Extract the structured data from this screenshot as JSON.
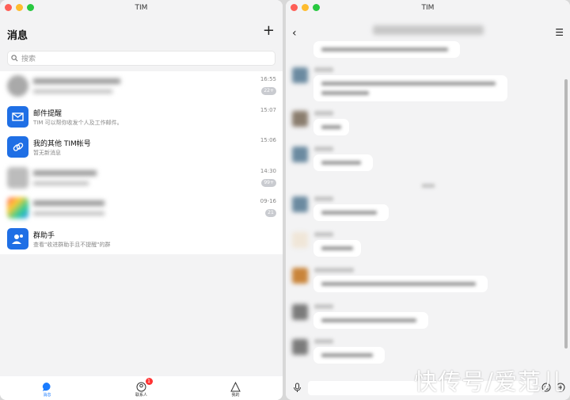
{
  "app": {
    "title": "TIM"
  },
  "left": {
    "heading": "消息",
    "plus": "+",
    "search_placeholder": "搜索",
    "rows": [
      {
        "name": "",
        "sub": "",
        "time": "16:55",
        "badge": "22+"
      },
      {
        "name": "邮件提醒",
        "sub": "TIM 可以帮你收发个人及工作邮件。",
        "time": "15:07",
        "badge": ""
      },
      {
        "name": "我的其他 TIM帐号",
        "sub": "暂无新消息",
        "time": "15:06",
        "badge": ""
      },
      {
        "name": "",
        "sub": "",
        "time": "14:30",
        "badge": "99+"
      },
      {
        "name": "",
        "sub": "",
        "time": "09-16",
        "badge": "21"
      },
      {
        "name": "群助手",
        "sub": "查看\"收进群助手且不提醒\"的群",
        "time": "",
        "badge": ""
      }
    ],
    "tabs": [
      {
        "label": "消息",
        "badge": ""
      },
      {
        "label": "联系人",
        "badge": "1"
      },
      {
        "label": "我的",
        "badge": ""
      }
    ]
  },
  "right": {
    "back": "‹",
    "menu": "☰",
    "watermark": "快传号/爱范儿"
  },
  "colors": {
    "accent": "#1a7cff"
  }
}
